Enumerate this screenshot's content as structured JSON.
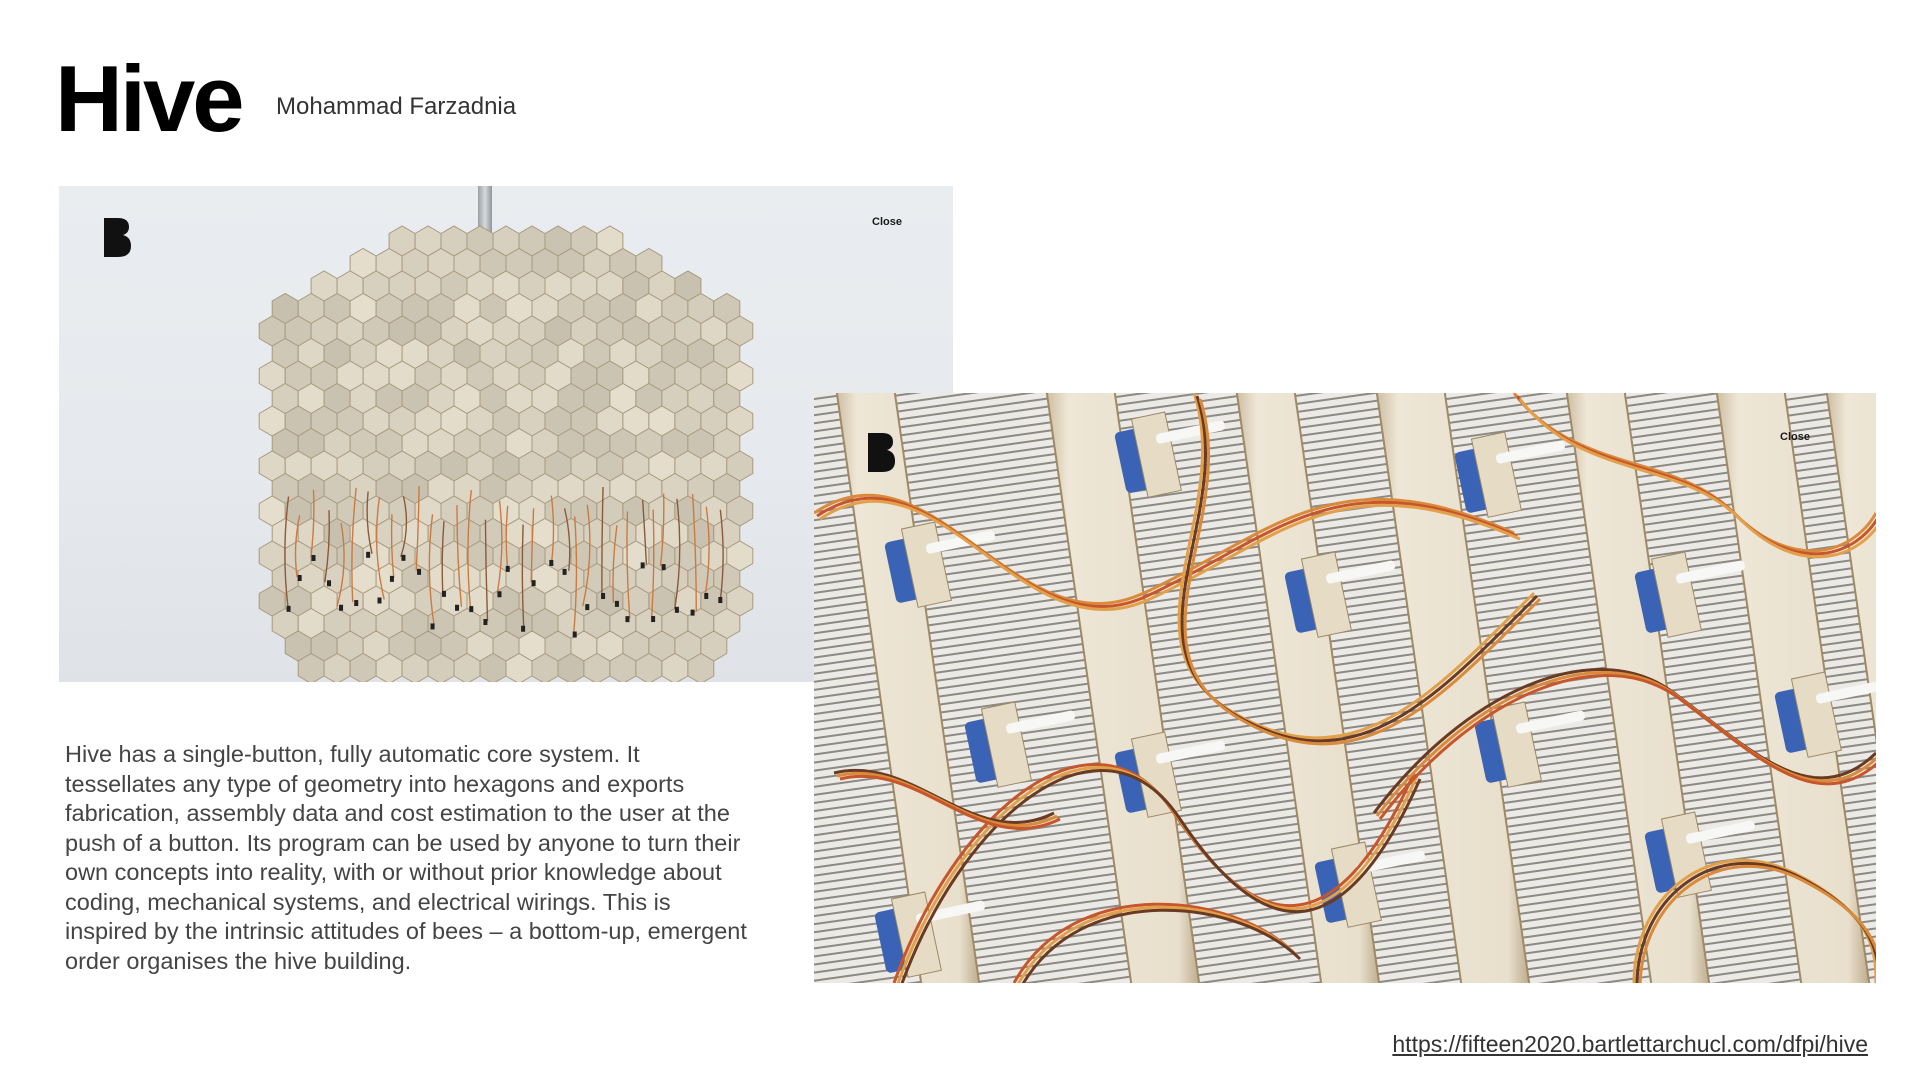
{
  "slide": {
    "title": "Hive",
    "author": "Mohammad Farzadnia",
    "description": "Hive has a single-button, fully automatic core system. It tessellates any type of geometry into hexagons and exports fabrication, assembly data and cost estimation to the user at the push of a button. Its program can be used by anyone to turn their own concepts into reality, with or without prior knowledge about coding, mechanical systems, and electrical wirings. This is inspired by the intrinsic attitudes of bees – a bottom-up, emergent order organises the hive building.",
    "source_url": "https://fifteen2020.bartlettarchucl.com/dfpi/hive"
  },
  "photos": [
    {
      "subject": "hexagon hive installation hanging from rod",
      "overlay_logo": "bartlett-b-logo",
      "overlay_close_label": "Close"
    },
    {
      "subject": "close-up of servo motors, plywood ribs and wiring",
      "overlay_logo": "bartlett-b-logo",
      "overlay_close_label": "Close"
    }
  ],
  "colors": {
    "title": "#000000",
    "body_text": "#444444",
    "wood": "#d9ccb0",
    "wire_orange": "#d98a3a",
    "servo_blue": "#3a63b5"
  }
}
